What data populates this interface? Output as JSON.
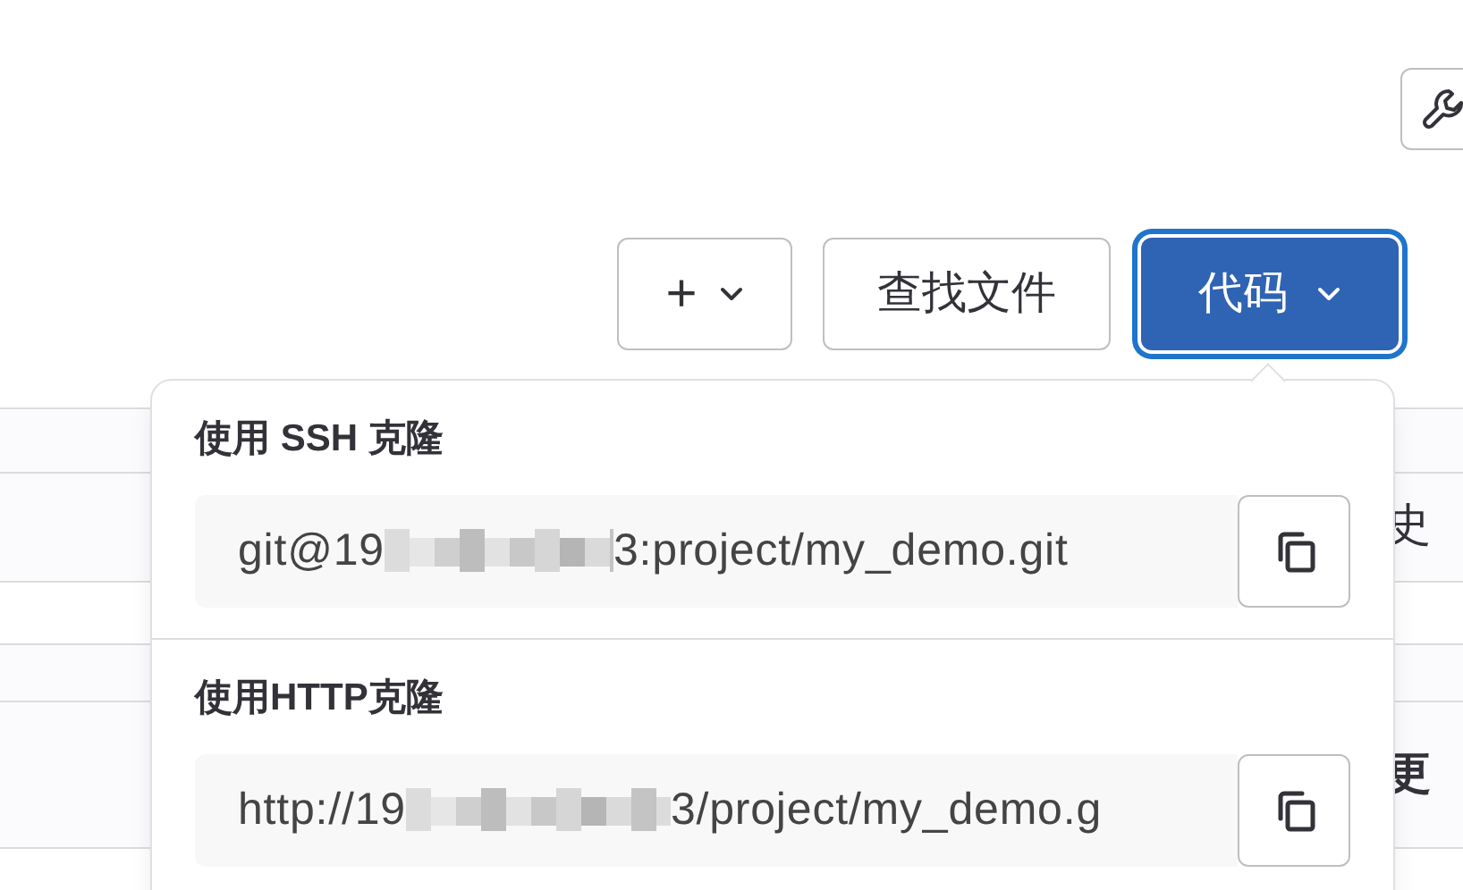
{
  "toolbar": {
    "add_button": {
      "label": "+"
    },
    "find_file_button": {
      "label": "查找文件"
    },
    "code_button": {
      "label": "代码",
      "expanded": true
    }
  },
  "background_texts": [
    "史",
    "更"
  ],
  "clone_menu": {
    "sections": [
      {
        "title": "使用 SSH 克隆",
        "value_prefix": "git@19",
        "value_suffix": "3:project/my_demo.git"
      },
      {
        "title": "使用HTTP克隆",
        "value_prefix": "http://19",
        "value_suffix": "3/project/my_demo.g"
      }
    ]
  }
}
